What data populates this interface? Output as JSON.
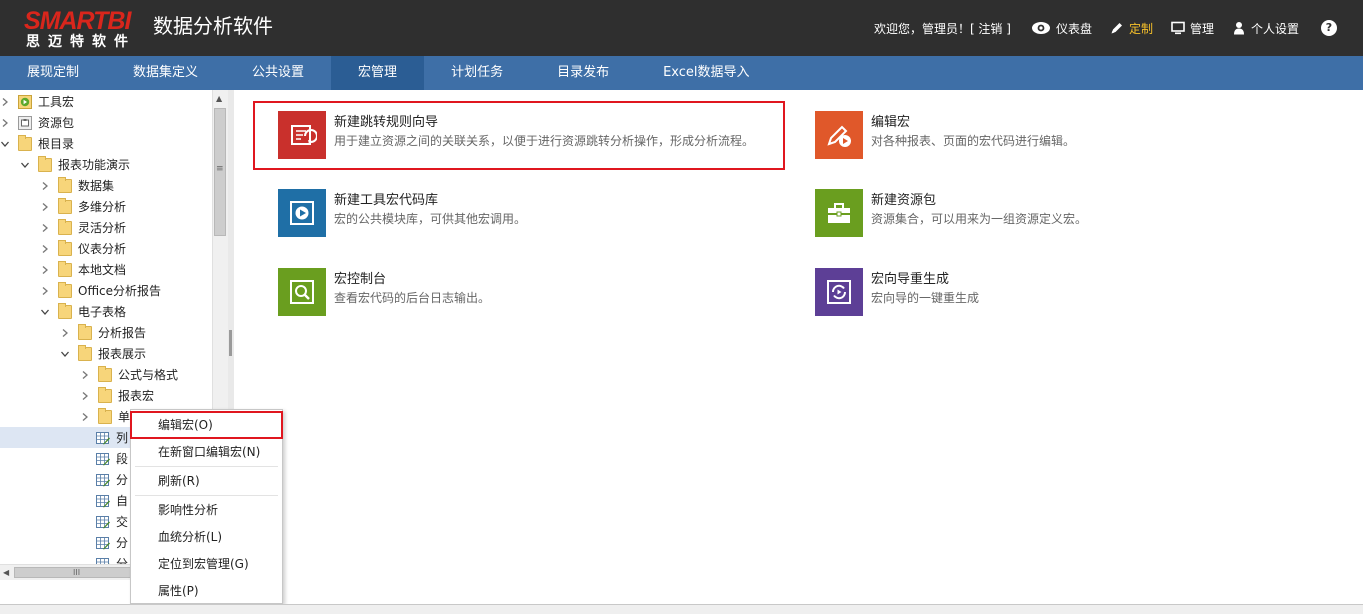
{
  "header": {
    "logo_text": "SMARTBI",
    "logo_sub": "思迈特软件",
    "app_title": "数据分析软件",
    "welcome": "欢迎您，管理员！[ 注销 ]",
    "nav_items": [
      {
        "label": "仪表盘",
        "icon": "eye-icon"
      },
      {
        "label": "定制",
        "icon": "pencil-icon"
      },
      {
        "label": "管理",
        "icon": "monitor-icon"
      },
      {
        "label": "个人设置",
        "icon": "user-icon"
      }
    ],
    "help": "?",
    "active_color": "#f6c02a"
  },
  "tabs": [
    {
      "label": "展现定制"
    },
    {
      "label": "数据集定义"
    },
    {
      "label": "公共设置"
    },
    {
      "label": "宏管理"
    },
    {
      "label": "计划任务"
    },
    {
      "label": "目录发布"
    },
    {
      "label": "Excel数据导入"
    }
  ],
  "tree": [
    {
      "label": "工具宏"
    },
    {
      "label": "资源包"
    },
    {
      "label": "根目录"
    },
    {
      "label": "报表功能演示"
    },
    {
      "label": "数据集"
    },
    {
      "label": "多维分析"
    },
    {
      "label": "灵活分析"
    },
    {
      "label": "仪表分析"
    },
    {
      "label": "本地文档"
    },
    {
      "label": "Office分析报告"
    },
    {
      "label": "电子表格"
    },
    {
      "label": "分析报告"
    },
    {
      "label": "报表展示"
    },
    {
      "label": "公式与格式"
    },
    {
      "label": "报表宏"
    },
    {
      "label": "单"
    },
    {
      "label": "列"
    },
    {
      "label": "段"
    },
    {
      "label": "分"
    },
    {
      "label": "自"
    },
    {
      "label": "交"
    },
    {
      "label": "分"
    },
    {
      "label": "分"
    }
  ],
  "cards": [
    {
      "title": "新建跳转规则向导",
      "desc": "用于建立资源之间的关联关系，以便于进行资源跳转分析操作，形成分析流程。",
      "color": "#c9302c",
      "icon": "jump-rule-icon"
    },
    {
      "title": "编辑宏",
      "desc": "对各种报表、页面的宏代码进行编辑。",
      "color": "#e0582a",
      "icon": "edit-macro-icon"
    },
    {
      "title": "新建工具宏代码库",
      "desc": "宏的公共模块库，可供其他宏调用。",
      "color": "#1f6fa6",
      "icon": "play-library-icon"
    },
    {
      "title": "新建资源包",
      "desc": "资源集合，可以用来为一组资源定义宏。",
      "color": "#6a9e1f",
      "icon": "toolbox-icon"
    },
    {
      "title": "宏控制台",
      "desc": "查看宏代码的后台日志输出。",
      "color": "#6a9e1f",
      "icon": "console-search-icon"
    },
    {
      "title": "宏向导重生成",
      "desc": "宏向导的一键重生成",
      "color": "#5d3f96",
      "icon": "regenerate-icon"
    }
  ],
  "context_menu": [
    {
      "label": "编辑宏(O)"
    },
    {
      "label": "在新窗口编辑宏(N)"
    },
    {
      "label": "刷新(R)"
    },
    {
      "label": "影响性分析"
    },
    {
      "label": "血统分析(L)"
    },
    {
      "label": "定位到宏管理(G)"
    },
    {
      "label": "属性(P)"
    }
  ],
  "scrollbar": {
    "h_grip": "III",
    "v_grip": "≡"
  }
}
